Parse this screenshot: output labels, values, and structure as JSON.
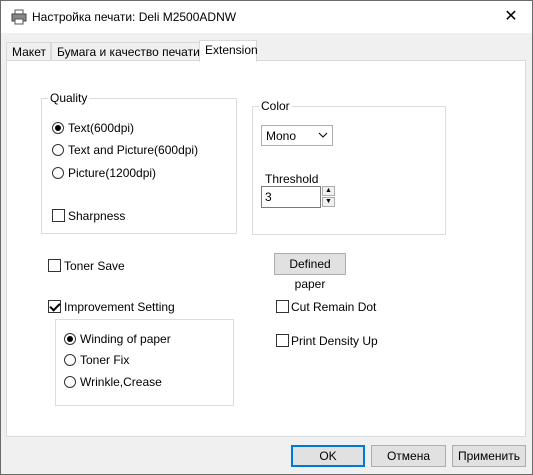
{
  "window": {
    "title": "Настройка печати: Deli M2500ADNW",
    "close_glyph": "✕"
  },
  "tabs": [
    {
      "label": "Макет"
    },
    {
      "label": "Бумага и качество печати"
    },
    {
      "label": "Extension"
    }
  ],
  "quality": {
    "title": "Quality",
    "options": [
      {
        "label": "Text(600dpi)",
        "checked": true
      },
      {
        "label": "Text and Picture(600dpi)",
        "checked": false
      },
      {
        "label": "Picture(1200dpi)",
        "checked": false
      }
    ],
    "sharpness_label": "Sharpness",
    "sharpness_checked": false
  },
  "color": {
    "title": "Color",
    "selected": "Mono",
    "threshold_label": "Threshold",
    "threshold_value": "3"
  },
  "toner_save": {
    "label": "Toner Save",
    "checked": false
  },
  "defined_paper_button": "Defined paper",
  "improvement": {
    "label": "Improvement Setting",
    "checked": true,
    "options": [
      {
        "label": "Winding of paper",
        "checked": true
      },
      {
        "label": "Toner Fix",
        "checked": false
      },
      {
        "label": "Wrinkle,Crease",
        "checked": false
      }
    ]
  },
  "cut_remain_dot": {
    "label": "Cut Remain Dot",
    "checked": false
  },
  "print_density_up": {
    "label": "Print Density Up",
    "checked": false
  },
  "buttons": {
    "ok": "OK",
    "cancel": "Отмена",
    "apply": "Применить"
  }
}
